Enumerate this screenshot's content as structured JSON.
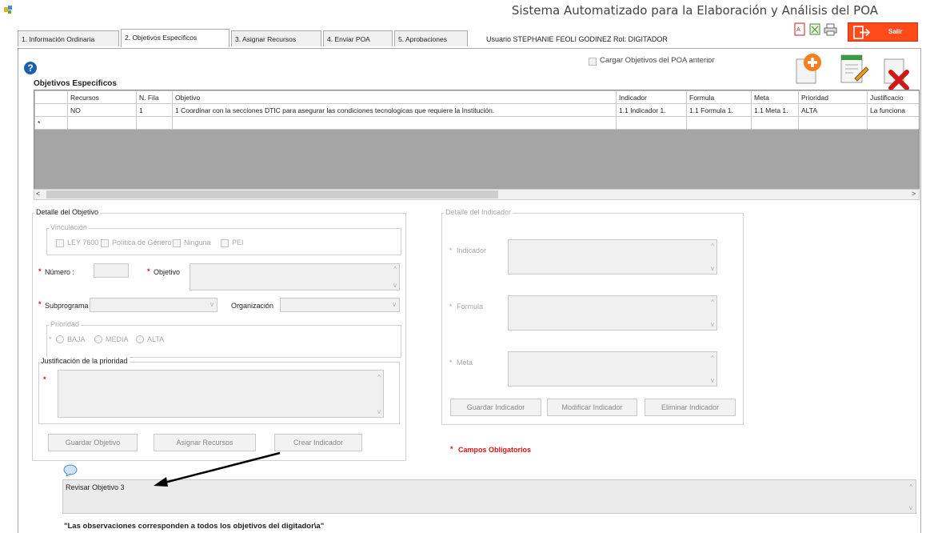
{
  "app": {
    "title": "Sistema Automatizado para la Elaboración y Análisis del POA"
  },
  "tabs": [
    {
      "label": "1. Información Ordinaria"
    },
    {
      "label": "2. Objetivos Especificos"
    },
    {
      "label": "3. Asignar Recursos"
    },
    {
      "label": "4. Enviar POA"
    },
    {
      "label": "5. Aprobaciones"
    }
  ],
  "user": {
    "text": "Usuario STEPHANIE FEOLI GODINEZ  Rol: DIGITADOR"
  },
  "toolbar": {
    "salir_label": "Salir"
  },
  "cargar_label": "Cargar Objetivos del POA anterior",
  "section_title": "Objetivos Especificos",
  "grid": {
    "columns": [
      "Recursos",
      "N. Fila",
      "Objetivo",
      "Indicador",
      "Formula",
      "Meta",
      "Prioridad",
      "Justificacio"
    ],
    "rows": [
      [
        "NO",
        "1",
        "1 Coordinar con la secciones DTIC para asegurar las condiciones tecnologicas que requiere la Institución.",
        "1.1 Indicador 1.",
        "1.1 Formula 1.",
        "1.1 Meta 1.",
        "ALTA",
        "La funciona"
      ]
    ],
    "new_row_marker": "*"
  },
  "detalle_objetivo": {
    "legend": "Detalle del Objetivo",
    "vinculacion": {
      "legend": "Vinculación",
      "options": [
        "LEY 7600",
        "Política de Género",
        "Ninguna",
        "PEI"
      ]
    },
    "numero_label": "Número :",
    "objetivo_label": "Objetivo",
    "subprograma_label": "Subprograma",
    "organizacion_label": "Organización",
    "prioridad": {
      "legend": "Prioridad",
      "options": [
        "BAJA",
        "MEDIA",
        "ALTA"
      ]
    },
    "justificacion_legend": "Justificación de la prioridad",
    "buttons": {
      "guardar": "Guardar Objetivo",
      "asignar": "Asignar Recursos",
      "crear": "Crear Indicador"
    }
  },
  "detalle_indicador": {
    "legend": "Detalle del Indicador",
    "indicador_label": "Indicador",
    "formula_label": "Formula",
    "meta_label": "Meta",
    "buttons": {
      "guardar": "Guardar Indicador",
      "modificar": "Modificar Indicador",
      "eliminar": "Eliminar Indicador"
    }
  },
  "required_mark": "*",
  "campos_obligatorios": "Campos Obligatorios",
  "observation": {
    "text": "Revisar Objetivo 3"
  },
  "footer_note": "\"Las observaciones corresponden a todos los objetivos del digitador\\a\"",
  "colors": {
    "accent": "#1b5fb4",
    "danger": "#e01010",
    "salir": "#ff4a1c"
  }
}
